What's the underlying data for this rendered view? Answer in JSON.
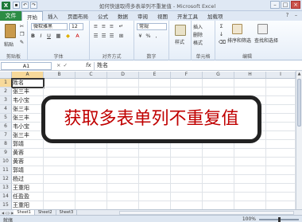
{
  "window": {
    "title": "如何快速取得多表单列不重复值 - Microsoft Excel",
    "app_icon": "X",
    "accent_color": "#2c8c44"
  },
  "tabs": [
    "文件",
    "开始",
    "插入",
    "页面布局",
    "公式",
    "数据",
    "审阅",
    "视图",
    "开发工具",
    "加载项"
  ],
  "ribbon": {
    "clipboard": {
      "paste": "粘贴",
      "label": "剪贴板"
    },
    "font": {
      "name": "微软雅黑",
      "size": "12",
      "label": "字体"
    },
    "alignment": {
      "label": "对齐方式"
    },
    "number": {
      "format": "常规",
      "label": "数字"
    },
    "styles": {
      "button": "样式"
    },
    "cells": {
      "insert": "插入",
      "delete": "删除",
      "format": "格式",
      "label": "单元格"
    },
    "editing": {
      "sort_filter": "排序和筛选",
      "find_select": "查找和选择",
      "label": "编辑"
    }
  },
  "formula_bar": {
    "name_box": "A1",
    "fx": "fx",
    "value": "姓名"
  },
  "sheet": {
    "columns": [
      "A",
      "B",
      "C",
      "D",
      "E",
      "F",
      "G",
      "H",
      "I"
    ],
    "row_numbers": [
      "1",
      "2",
      "3",
      "4",
      "5",
      "6",
      "7",
      "8",
      "9",
      "10",
      "11",
      "12",
      "13",
      "14",
      "15",
      "16"
    ],
    "col_a": [
      "姓名",
      "张三丰",
      "韦小宝",
      "张三丰",
      "张三丰",
      "韦小宝",
      "张三丰",
      "郭靖",
      "黄蓉",
      "黄蓉",
      "郭靖",
      "杨过",
      "王重阳",
      "任盈盈",
      "王重阳",
      ""
    ]
  },
  "callout": {
    "text": "获取多表单列不重复值"
  },
  "sheet_tabs": [
    "Sheet1",
    "Sheet2",
    "Sheet3"
  ],
  "status": {
    "left": "就绪",
    "zoom": "100%"
  }
}
